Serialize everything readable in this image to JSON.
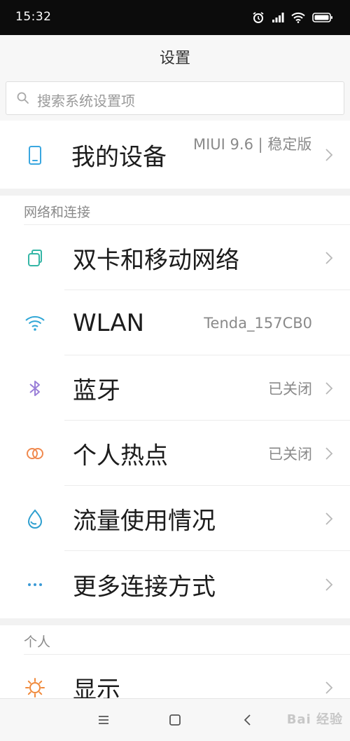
{
  "status_bar": {
    "time": "15:32",
    "icons": [
      "alarm-icon",
      "signal-icon",
      "wifi-icon",
      "battery-icon"
    ]
  },
  "header": {
    "title": "设置"
  },
  "search": {
    "placeholder": "搜索系统设置项"
  },
  "device": {
    "label": "我的设备",
    "value": "MIUI 9.6 | 稳定版"
  },
  "sections": [
    {
      "title": "网络和连接",
      "items": [
        {
          "icon": "dual-sim-icon",
          "label": "双卡和移动网络",
          "value": ""
        },
        {
          "icon": "wifi-icon",
          "label": "WLAN",
          "value": "Tenda_157CB0"
        },
        {
          "icon": "bluetooth-icon",
          "label": "蓝牙",
          "value": "已关闭"
        },
        {
          "icon": "hotspot-icon",
          "label": "个人热点",
          "value": "已关闭"
        },
        {
          "icon": "data-usage-icon",
          "label": "流量使用情况",
          "value": ""
        },
        {
          "icon": "more-icon",
          "label": "更多连接方式",
          "value": ""
        }
      ]
    },
    {
      "title": "个人",
      "items": [
        {
          "icon": "display-icon",
          "label": "显示",
          "value": ""
        }
      ]
    }
  ],
  "nav_bar": {
    "buttons": [
      "menu-icon",
      "home-icon",
      "back-icon"
    ]
  },
  "watermark": "Bai 经验",
  "colors": {
    "status_bar_bg": "#0c0c0c",
    "device_icon": "#3aa7e0",
    "dual_sim_icon": "#35b6a6",
    "wifi_icon": "#2fa6d6",
    "bluetooth_icon": "#9a7fd8",
    "hotspot_icon": "#f0894e",
    "data_usage_icon": "#2e9fcf",
    "more_icon": "#3b9ad6",
    "display_icon": "#f08a3c"
  }
}
